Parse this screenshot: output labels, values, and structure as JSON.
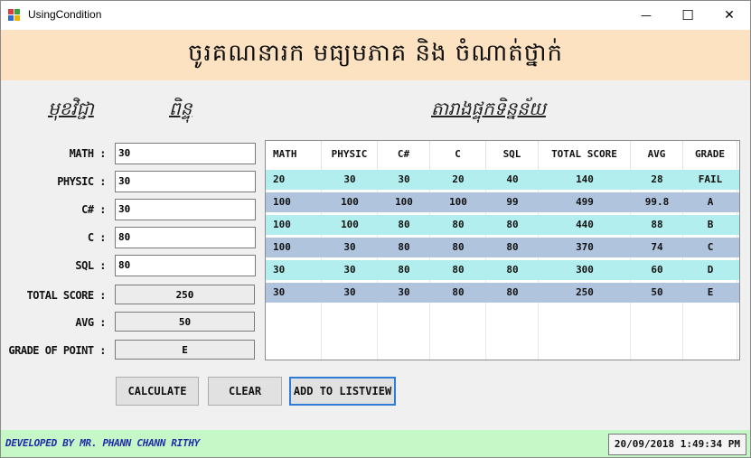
{
  "window": {
    "title": "UsingCondition",
    "minimize_glyph": "—",
    "maximize_glyph": "☐",
    "close_glyph": "✕"
  },
  "header": {
    "title": "ចូរគណនារក មធ្យមភាគ និង ចំណាត់ថ្នាក់"
  },
  "labels": {
    "subject": "មុខវិជ្ជា",
    "score": "ពិន្ទុ",
    "table": "តារាងផ្ទុកទិន្នន័យ"
  },
  "form": {
    "fields": [
      {
        "label": "MATH :",
        "value": "30"
      },
      {
        "label": "PHYSIC :",
        "value": "30"
      },
      {
        "label": "C# :",
        "value": "30"
      },
      {
        "label": "C :",
        "value": "80"
      },
      {
        "label": "SQL :",
        "value": "80"
      }
    ],
    "outputs": [
      {
        "label": "TOTAL SCORE :",
        "value": "250"
      },
      {
        "label": "AVG :",
        "value": "50"
      },
      {
        "label": "GRADE OF POINT :",
        "value": "E"
      }
    ]
  },
  "listview": {
    "columns": [
      "MATH",
      "PHYSIC",
      "C#",
      "C",
      "SQL",
      "TOTAL SCORE",
      "AVG",
      "GRADE"
    ],
    "rows": [
      [
        "20",
        "30",
        "30",
        "20",
        "40",
        "140",
        "28",
        "FAIL"
      ],
      [
        "100",
        "100",
        "100",
        "100",
        "99",
        "499",
        "99.8",
        "A"
      ],
      [
        "100",
        "100",
        "80",
        "80",
        "80",
        "440",
        "88",
        "B"
      ],
      [
        "100",
        "30",
        "80",
        "80",
        "80",
        "370",
        "74",
        "C"
      ],
      [
        "30",
        "30",
        "80",
        "80",
        "80",
        "300",
        "60",
        "D"
      ],
      [
        "30",
        "30",
        "30",
        "80",
        "80",
        "250",
        "50",
        "E"
      ]
    ],
    "row_colors": [
      "#b2eeee",
      "#b0c4de"
    ]
  },
  "buttons": {
    "calculate": "CALCULATE",
    "clear": "CLEAR",
    "add": "ADD TO LISTVIEW"
  },
  "status": {
    "developer": "DEVELOPED BY MR. PHANN CHANN RITHY",
    "datetime": "20/09/2018 1:49:34 PM"
  },
  "colors": {
    "header_bg": "#fde2c2",
    "status_bg": "#c6f7c6",
    "developer_text": "#1f2aa8",
    "focus_border": "#2f7bd8"
  }
}
